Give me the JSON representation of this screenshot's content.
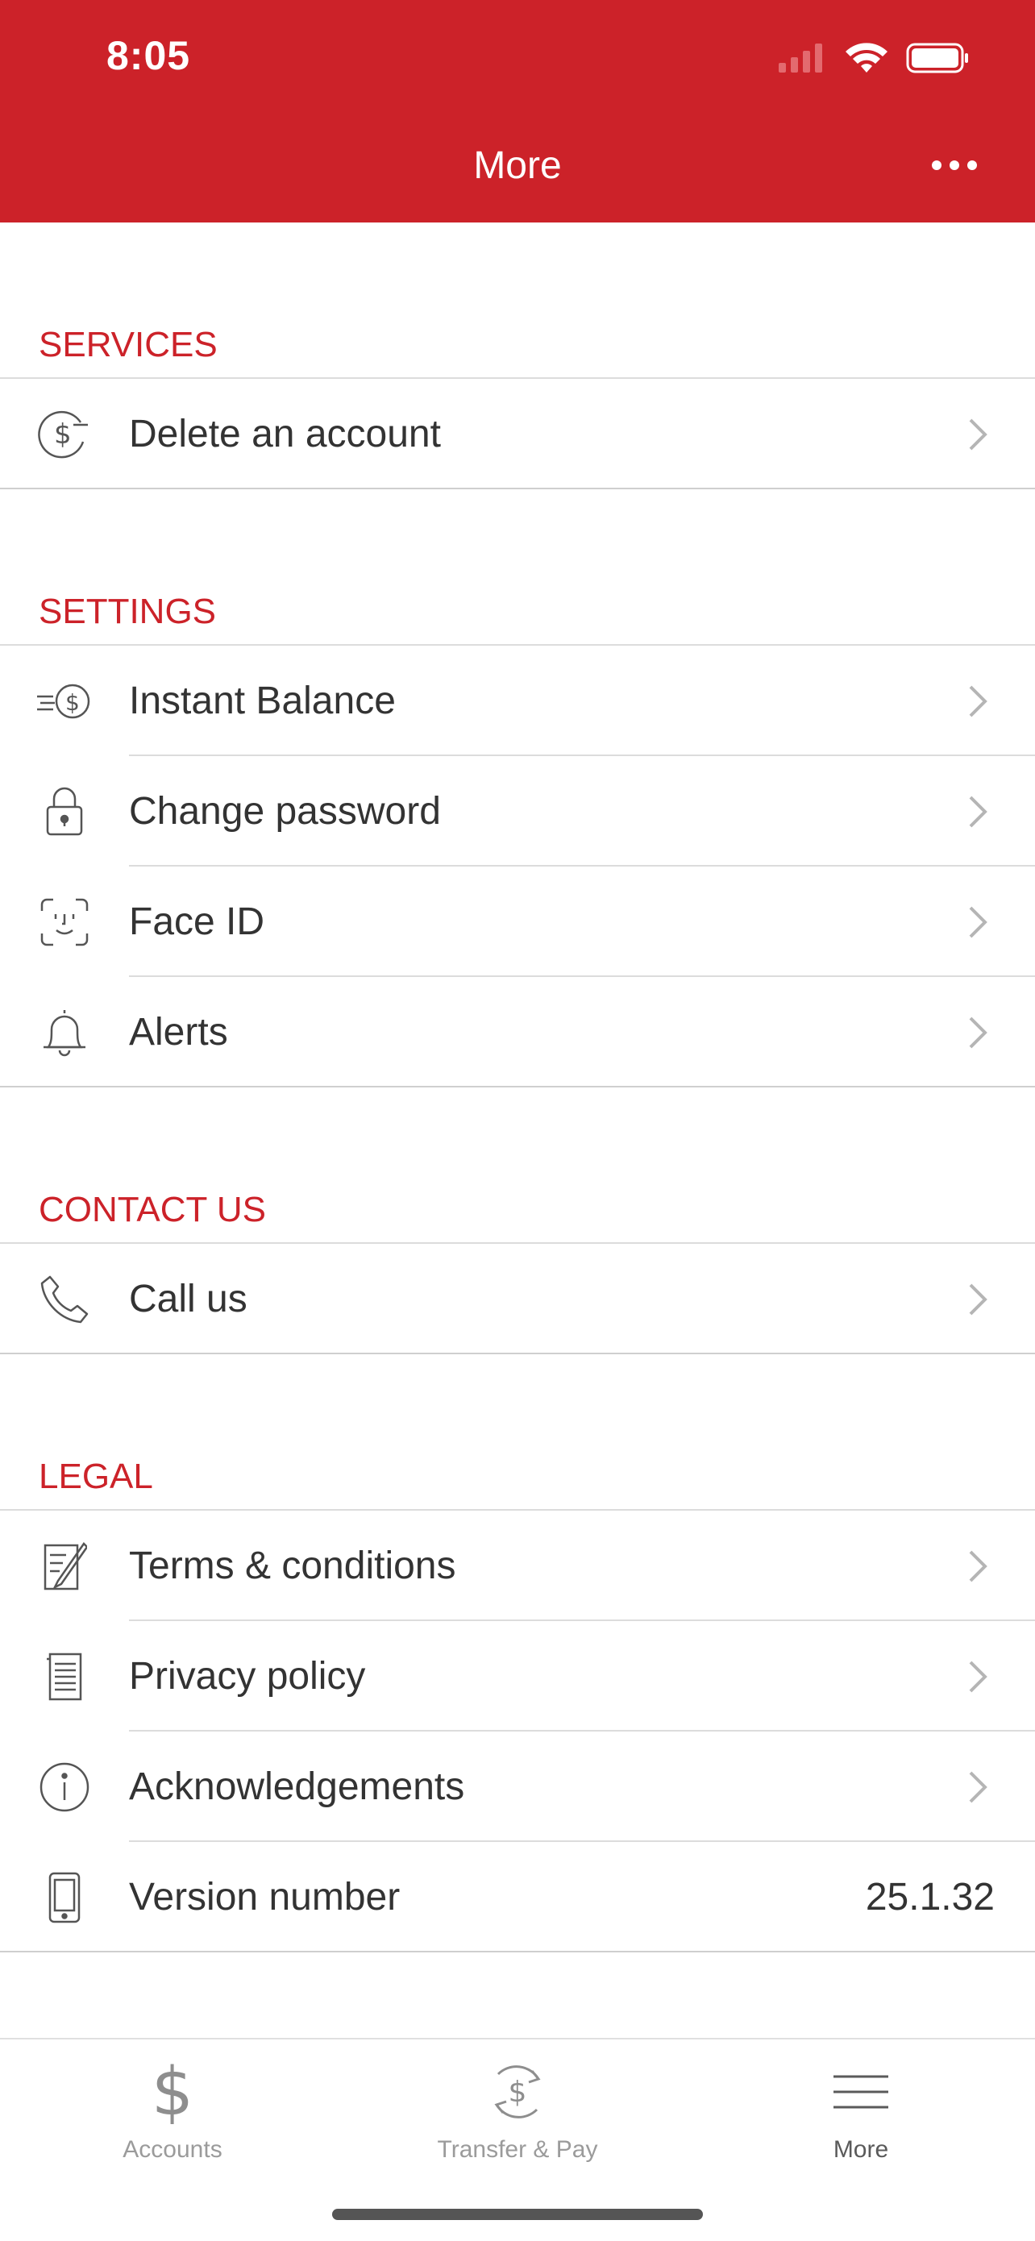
{
  "status_bar": {
    "time": "8:05"
  },
  "header": {
    "title": "More"
  },
  "sections": [
    {
      "title": "SERVICES",
      "items": [
        {
          "label": "Delete an account"
        }
      ]
    },
    {
      "title": "SETTINGS",
      "items": [
        {
          "label": "Instant Balance"
        },
        {
          "label": "Change password"
        },
        {
          "label": "Face ID"
        },
        {
          "label": "Alerts"
        }
      ]
    },
    {
      "title": "CONTACT US",
      "items": [
        {
          "label": "Call us"
        }
      ]
    },
    {
      "title": "LEGAL",
      "items": [
        {
          "label": "Terms & conditions"
        },
        {
          "label": "Privacy policy"
        },
        {
          "label": "Acknowledgements"
        },
        {
          "label": "Version number",
          "value": "25.1.32"
        }
      ]
    }
  ],
  "tabbar": {
    "tabs": [
      {
        "label": "Accounts"
      },
      {
        "label": "Transfer & Pay"
      },
      {
        "label": "More"
      }
    ]
  },
  "colors": {
    "brand_red": "#CC2229",
    "text": "#333333",
    "muted": "#9b9b9b"
  }
}
